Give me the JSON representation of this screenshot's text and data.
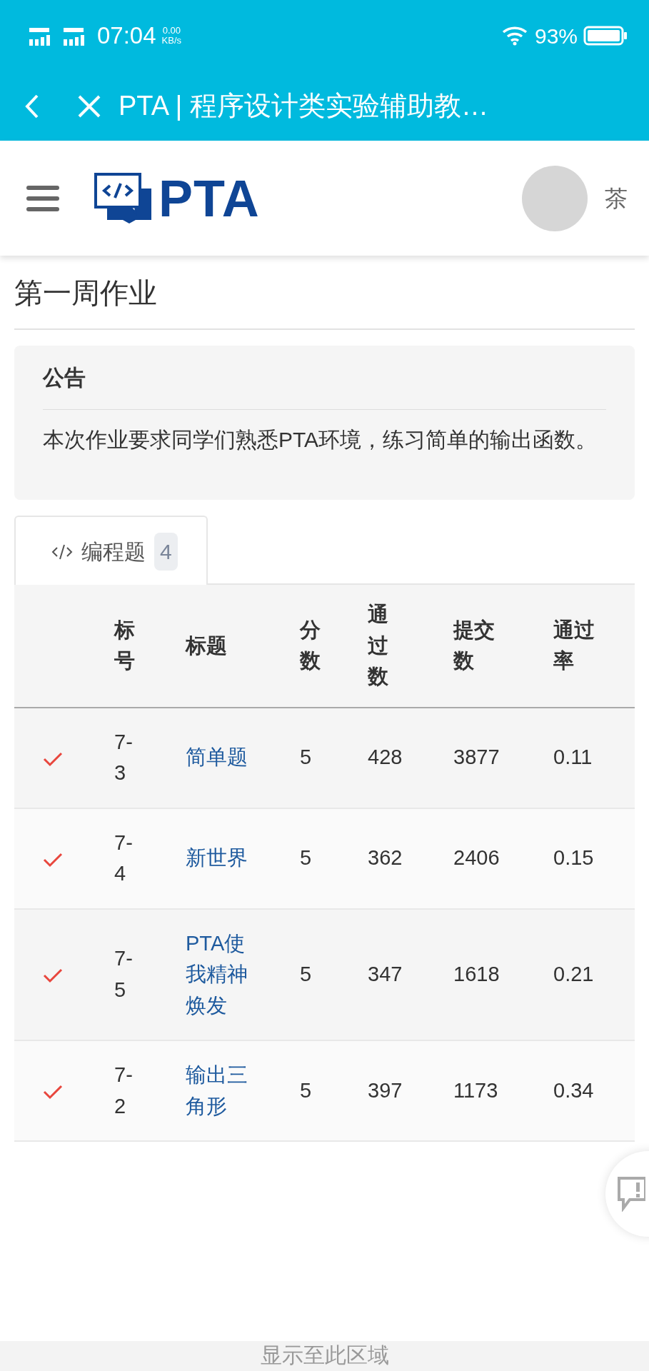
{
  "status_bar": {
    "time": "07:04",
    "net_speed": "0.00",
    "net_unit": "KB/s",
    "battery": "93%"
  },
  "browser_bar": {
    "title": "PTA | 程序设计类实验辅助教…"
  },
  "header": {
    "logo_text": "PTA",
    "user": "茶"
  },
  "page_title": "第一周作业",
  "notice": {
    "heading": "公告",
    "body": "本次作业要求同学们熟悉PTA环境，练习简单的输出函数。"
  },
  "tabs": [
    {
      "label": "编程题",
      "count": "4",
      "selected": true
    }
  ],
  "table": {
    "columns": [
      "标号",
      "标题",
      "分数",
      "通过数",
      "提交数",
      "通过率"
    ],
    "rows": [
      {
        "solved": true,
        "id": "7-3",
        "title": "简单题",
        "score": "5",
        "passed": "428",
        "submitted": "3877",
        "rate": "0.11"
      },
      {
        "solved": true,
        "id": "7-4",
        "title": "新世界",
        "score": "5",
        "passed": "362",
        "submitted": "2406",
        "rate": "0.15"
      },
      {
        "solved": true,
        "id": "7-5",
        "title": "PTA使我精神焕发",
        "score": "5",
        "passed": "347",
        "submitted": "1618",
        "rate": "0.21"
      },
      {
        "solved": true,
        "id": "7-2",
        "title": "输出三角形",
        "score": "5",
        "passed": "397",
        "submitted": "1173",
        "rate": "0.34"
      }
    ]
  },
  "footer_hint": "显示至此区域"
}
